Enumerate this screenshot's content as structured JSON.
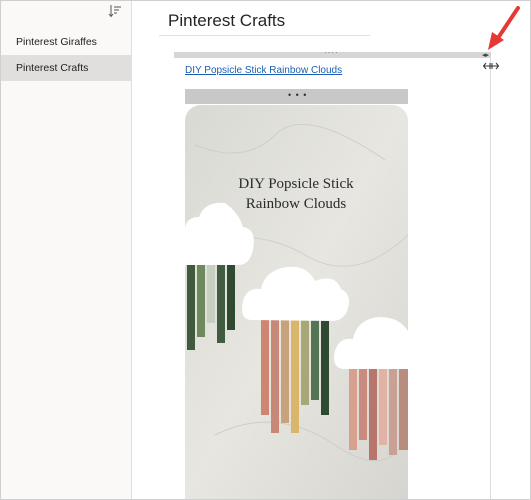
{
  "sidebar": {
    "pages": [
      {
        "label": "Pinterest Giraffes"
      },
      {
        "label": "Pinterest Crafts",
        "selected": true
      }
    ]
  },
  "main": {
    "page_title": "Pinterest Crafts",
    "note_container": {
      "link_text": "DIY Popsicle Stick Rainbow Clouds",
      "image": {
        "caption_line1": "DIY Popsicle Stick",
        "caption_line2": "Rainbow Clouds"
      }
    }
  },
  "colors": {
    "link": "#1a5fb4",
    "selected_item_bg": "#e1dfdd",
    "annotation_arrow": "#e53935"
  },
  "icons": [
    "sort-icon",
    "ellipsis-icon",
    "resize-arrows-icon",
    "resize-cursor-icon",
    "annotation-arrow-icon"
  ]
}
